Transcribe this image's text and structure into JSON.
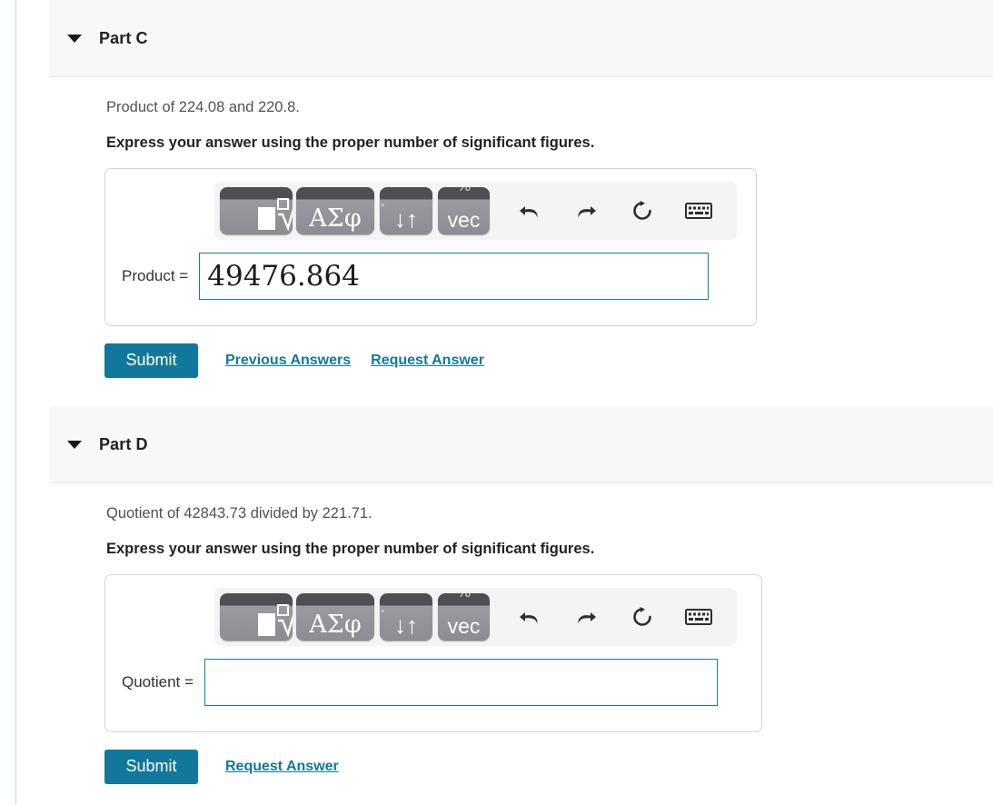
{
  "parts": [
    {
      "id": "part-c",
      "title": "Part C",
      "question": "Product of 224.08 and 220.8.",
      "instruction": "Express your answer using the proper number of significant figures.",
      "answer_label": "Product =",
      "answer_value": "49476.864",
      "answer_placeholder": "",
      "submit_label": "Submit",
      "links": [
        "Previous Answers",
        "Request Answer"
      ]
    },
    {
      "id": "part-d",
      "title": "Part D",
      "question": "Quotient of 42843.73 divided by 221.71.",
      "instruction": "Express your answer using the proper number of significant figures.",
      "answer_label": "Quotient =",
      "answer_value": "",
      "answer_placeholder": "",
      "submit_label": "Submit",
      "links": [
        "Request Answer"
      ]
    }
  ],
  "toolbar": {
    "keys": [
      {
        "name": "template-root-icon",
        "glyph": ""
      },
      {
        "name": "greek-symbols-key",
        "glyph": "ΑΣφ"
      },
      {
        "name": "arrows-key",
        "glyph": "↓↑"
      },
      {
        "name": "vector-key",
        "glyph": "vec"
      }
    ],
    "peek_symbols": {
      "percent": "%",
      "star": "*"
    },
    "icons": [
      {
        "name": "undo-icon"
      },
      {
        "name": "redo-icon"
      },
      {
        "name": "reset-icon"
      },
      {
        "name": "keyboard-icon"
      },
      {
        "name": "help-icon",
        "glyph": "?"
      }
    ]
  },
  "colors": {
    "accent": "#11789c",
    "input_border": "#1a7a9e",
    "header_bg": "#f8f8f8",
    "toolbar_bg": "#f4f4f4",
    "key_top": "#4f4f53",
    "key_bottom": "#8c8c93"
  }
}
